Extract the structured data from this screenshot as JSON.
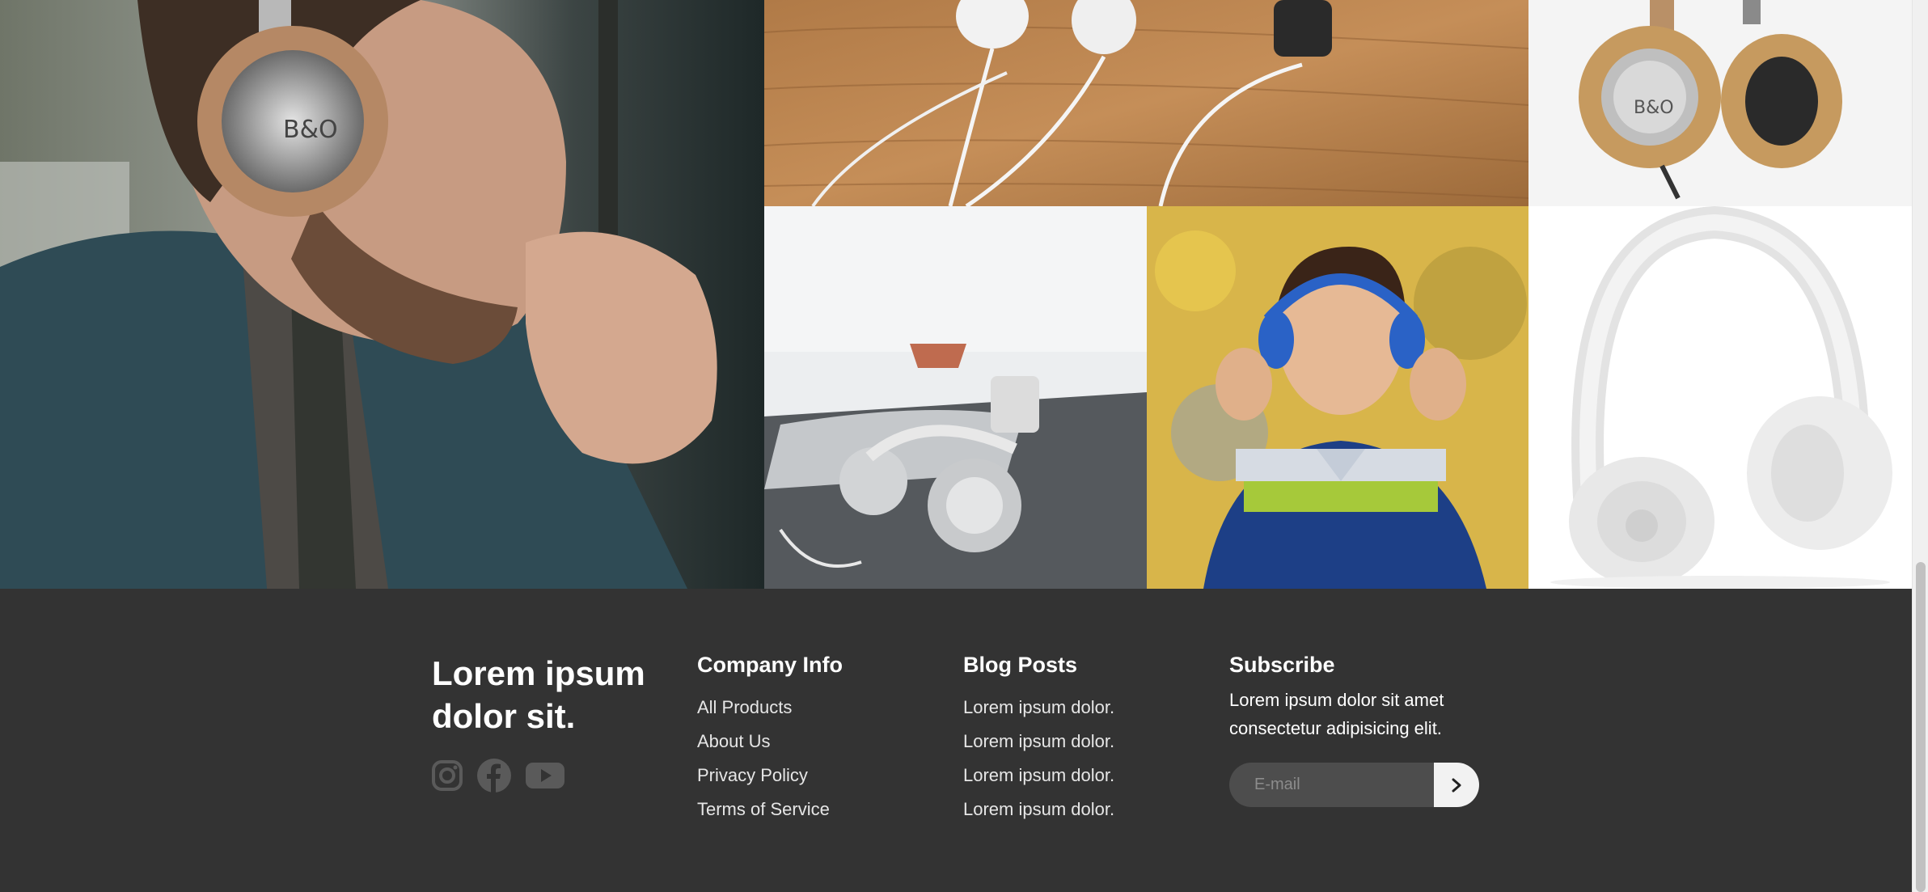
{
  "gallery": {
    "tiles": [
      {
        "name": "man-with-headphones"
      },
      {
        "name": "white-earphones-on-wood"
      },
      {
        "name": "tan-headphones-product"
      },
      {
        "name": "headphones-on-desk"
      },
      {
        "name": "boy-with-blue-headphones"
      },
      {
        "name": "white-headphones-product"
      }
    ]
  },
  "footer": {
    "brand": {
      "title_line1": "Lorem ipsum",
      "title_line2": "dolor sit.",
      "social_icons": [
        "instagram-icon",
        "facebook-icon",
        "youtube-icon"
      ]
    },
    "company": {
      "heading": "Company Info",
      "links": [
        "All Products",
        "About Us",
        "Privacy Policy",
        "Terms of Service"
      ]
    },
    "blog": {
      "heading": "Blog Posts",
      "links": [
        "Lorem ipsum dolor.",
        "Lorem ipsum dolor.",
        "Lorem ipsum dolor.",
        "Lorem ipsum dolor."
      ]
    },
    "subscribe": {
      "heading": "Subscribe",
      "text": "Lorem ipsum dolor sit amet consectetur adipisicing elit.",
      "email_placeholder": "E-mail",
      "button_icon": "chevron-right-icon"
    }
  },
  "colors": {
    "footer_bg": "#333333",
    "input_bg": "#4d4d4d",
    "button_bg": "#f2f2f2",
    "icon_gray": "#5a5a5a"
  }
}
